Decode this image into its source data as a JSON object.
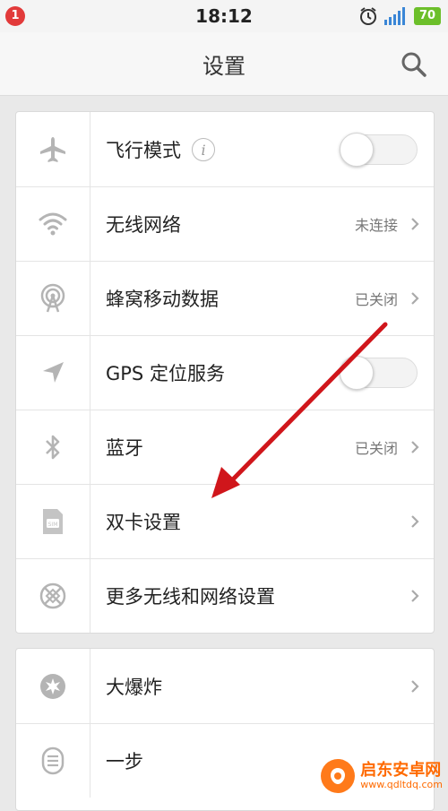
{
  "status_bar": {
    "notification_count": "1",
    "time": "18:12",
    "battery": "70"
  },
  "header": {
    "title": "设置"
  },
  "group_network": {
    "airplane": {
      "label": "飞行模式",
      "info": "i",
      "toggle_on": false
    },
    "wifi": {
      "label": "无线网络",
      "status": "未连接"
    },
    "cellular": {
      "label": "蜂窝移动数据",
      "status": "已关闭"
    },
    "gps": {
      "label": "GPS 定位服务",
      "toggle_on": false
    },
    "bluetooth": {
      "label": "蓝牙",
      "status": "已关闭"
    },
    "dual_sim": {
      "label": "双卡设置"
    },
    "more_wireless": {
      "label": "更多无线和网络设置"
    }
  },
  "group_other": {
    "boom": {
      "label": "大爆炸"
    },
    "onestep": {
      "label": "一步"
    }
  },
  "watermark": {
    "name": "启东安卓网",
    "url": "www.qdltdq.com"
  },
  "colors": {
    "accent_arrow": "#d0161b",
    "battery": "#6cbf2a",
    "badge": "#e23a3a"
  }
}
